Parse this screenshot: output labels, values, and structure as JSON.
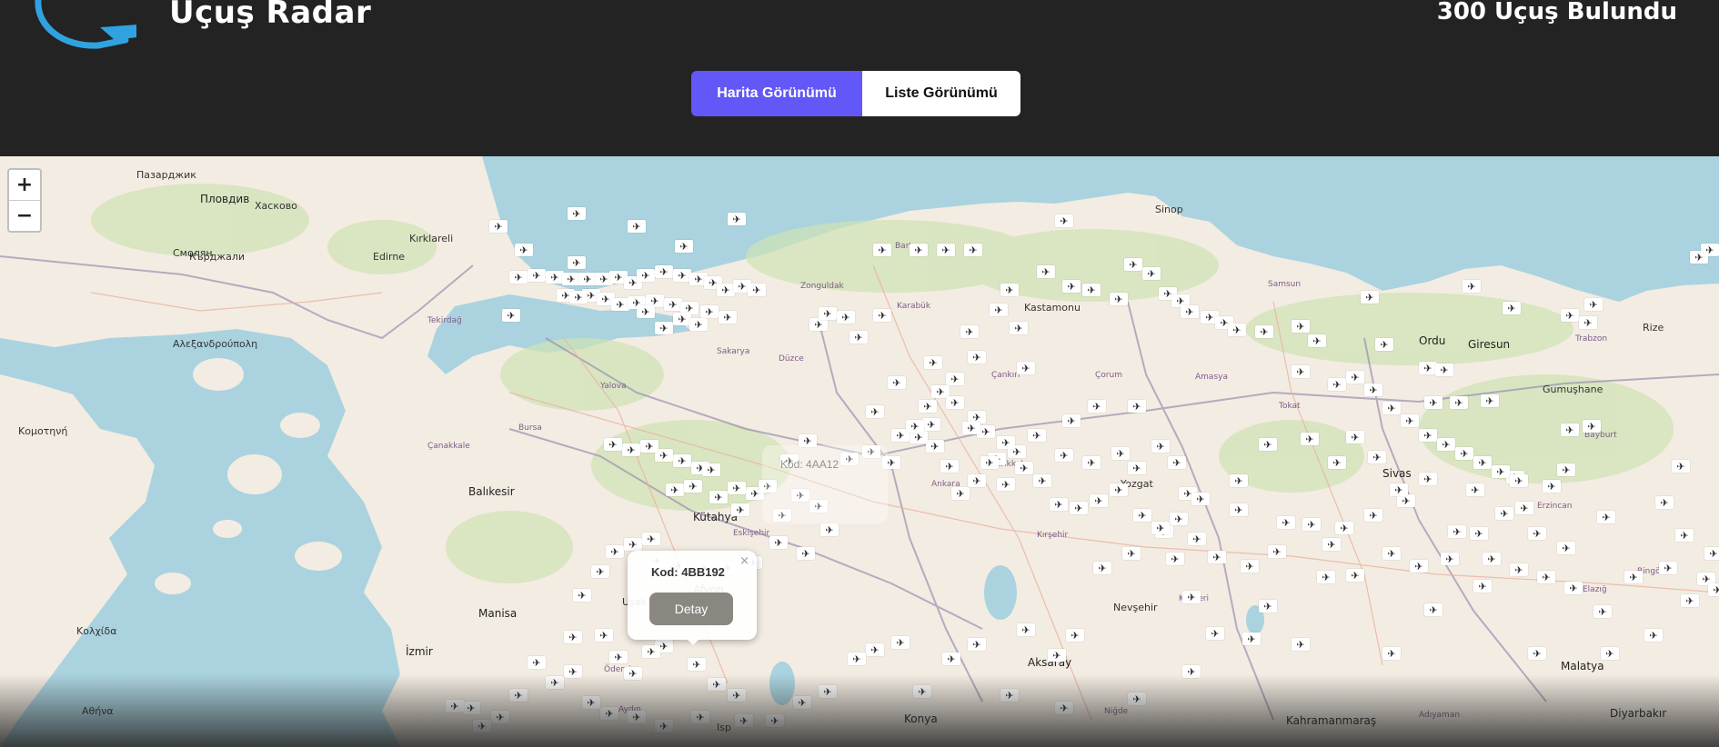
{
  "header": {
    "title": "Uçuş Radar",
    "flight_count": "300 Uçuş Bulundu",
    "tabs": {
      "map": "Harita Görünümü",
      "list": "Liste Görünümü"
    },
    "active_tab": "map"
  },
  "map": {
    "zoom_in": "+",
    "zoom_out": "−",
    "popup": {
      "code": "Kod: 4BB192",
      "button": "Detay",
      "close": "×"
    },
    "ghost_popup": {
      "code": "Kod: 4AA12"
    },
    "cities": [
      {
        "name": "Пловдив",
        "cls": "big"
      },
      {
        "name": "Edirne",
        "cls": ""
      },
      {
        "name": "Kırklareli",
        "cls": ""
      },
      {
        "name": "Tekirdağ",
        "cls": "small"
      },
      {
        "name": "Balıkesir",
        "cls": "big"
      },
      {
        "name": "Çanakkale",
        "cls": "small"
      },
      {
        "name": "Bursa",
        "cls": "small"
      },
      {
        "name": "Manisa",
        "cls": "big"
      },
      {
        "name": "İzmir",
        "cls": "big"
      },
      {
        "name": "Kütahya",
        "cls": "big"
      },
      {
        "name": "Uşak",
        "cls": ""
      },
      {
        "name": "Afyon",
        "cls": "big"
      },
      {
        "name": "Eskişehir",
        "cls": "small"
      },
      {
        "name": "Sakarya",
        "cls": "small"
      },
      {
        "name": "Zonguldak",
        "cls": "small"
      },
      {
        "name": "Bartın",
        "cls": "small"
      },
      {
        "name": "Karabük",
        "cls": "small"
      },
      {
        "name": "Kastamonu",
        "cls": ""
      },
      {
        "name": "Sinop",
        "cls": ""
      },
      {
        "name": "Çankırı",
        "cls": "small"
      },
      {
        "name": "Ankara",
        "cls": "small"
      },
      {
        "name": "Kırıkkale",
        "cls": "small"
      },
      {
        "name": "Çorum",
        "cls": "small"
      },
      {
        "name": "Amasya",
        "cls": "small"
      },
      {
        "name": "Samsun",
        "cls": "small"
      },
      {
        "name": "Tokat",
        "cls": "small"
      },
      {
        "name": "Ordu",
        "cls": "big"
      },
      {
        "name": "Giresun",
        "cls": "big"
      },
      {
        "name": "Trabzon",
        "cls": "small"
      },
      {
        "name": "Rize",
        "cls": ""
      },
      {
        "name": "Gumuşhane",
        "cls": ""
      },
      {
        "name": "Bayburt",
        "cls": "small"
      },
      {
        "name": "Sivas",
        "cls": "big"
      },
      {
        "name": "Yozgat",
        "cls": ""
      },
      {
        "name": "Kırşehir",
        "cls": "small"
      },
      {
        "name": "Nevşehir",
        "cls": ""
      },
      {
        "name": "Aksaray",
        "cls": "big"
      },
      {
        "name": "Kayseri",
        "cls": "small"
      },
      {
        "name": "Niğde",
        "cls": "small"
      },
      {
        "name": "Konya",
        "cls": "big"
      },
      {
        "name": "Malatya",
        "cls": "big"
      },
      {
        "name": "Erzincan",
        "cls": "small"
      },
      {
        "name": "Elazığ",
        "cls": "small"
      },
      {
        "name": "Bingöl",
        "cls": "small"
      },
      {
        "name": "Diyarbakır",
        "cls": "big"
      },
      {
        "name": "Kahramanmaraş",
        "cls": "big"
      },
      {
        "name": "Adıyaman",
        "cls": "small"
      },
      {
        "name": "Isp",
        "cls": ""
      },
      {
        "name": "Κομοτηνή",
        "cls": ""
      },
      {
        "name": "Αλεξανδρούπολη",
        "cls": ""
      },
      {
        "name": "Κολχίδα",
        "cls": ""
      },
      {
        "name": "Αθήνα",
        "cls": ""
      },
      {
        "name": "Смолян",
        "cls": ""
      },
      {
        "name": "Кърджали",
        "cls": ""
      },
      {
        "name": "Хасково",
        "cls": ""
      },
      {
        "name": "Пазарджик",
        "cls": ""
      },
      {
        "name": "Düzce",
        "cls": "small"
      },
      {
        "name": "Yalova",
        "cls": "small"
      },
      {
        "name": "Ödemiş",
        "cls": "small"
      },
      {
        "name": "Aydın",
        "cls": "small"
      }
    ]
  },
  "colors": {
    "accent": "#6357f7",
    "sea": "#aad3df",
    "land": "#f3ece2",
    "header": "#232323"
  }
}
